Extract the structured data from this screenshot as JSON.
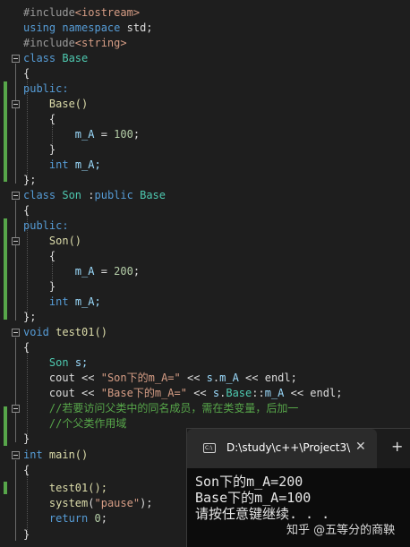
{
  "code": {
    "l1": [
      "#include",
      "<iostream>"
    ],
    "l2": [
      "using",
      "namespace",
      "std;"
    ],
    "l3": [
      "#include",
      "<string>"
    ],
    "l4": [
      "class",
      "Base"
    ],
    "l5": "{",
    "l6": "public:",
    "l7": "Base()",
    "l8": "{",
    "l9": [
      "m_A",
      " = ",
      "100",
      ";"
    ],
    "l10": "}",
    "l11": [
      "int",
      " m_A;"
    ],
    "l12": "};",
    "l13": [
      "class",
      "Son",
      " :",
      "public",
      "Base"
    ],
    "l14": "{",
    "l15": "public:",
    "l16": "Son()",
    "l17": "{",
    "l18": [
      "m_A",
      " = ",
      "200",
      ";"
    ],
    "l19": "}",
    "l20": [
      "int",
      " m_A;"
    ],
    "l21": "};",
    "l22": [
      "void",
      " test01()"
    ],
    "l23": "{",
    "l24": [
      "Son",
      " s;"
    ],
    "l25": [
      "cout",
      " << ",
      "\"Son下的m_A=\"",
      " << ",
      "s",
      ".",
      "m_A",
      " << ",
      "endl",
      ";"
    ],
    "l26": [
      "cout",
      " << ",
      "\"Base下的m_A=\"",
      " << ",
      "s",
      ".",
      "Base",
      "::",
      "m_A",
      " << ",
      "endl",
      ";"
    ],
    "l27": "//若要访问父类中的同名成员，需在类变量，后加一",
    "l28": "//个父类作用域",
    "l29": "}",
    "l30": [
      "int",
      " main()"
    ],
    "l31": "{",
    "l32": "test01();",
    "l33": [
      "system",
      "(",
      "\"pause\"",
      ");"
    ],
    "l34": [
      "return",
      " ",
      "0",
      ";"
    ],
    "l35": "}"
  },
  "console": {
    "tab_title": "D:\\study\\c++\\Project3\\",
    "icon_text": "C:\\",
    "close_glyph": "✕",
    "add_glyph": "+",
    "lines": [
      "Son下的m_A=200",
      "Base下的m_A=100",
      "请按任意键继续. . ."
    ]
  },
  "watermark": "知乎 @五等分的商鞅"
}
